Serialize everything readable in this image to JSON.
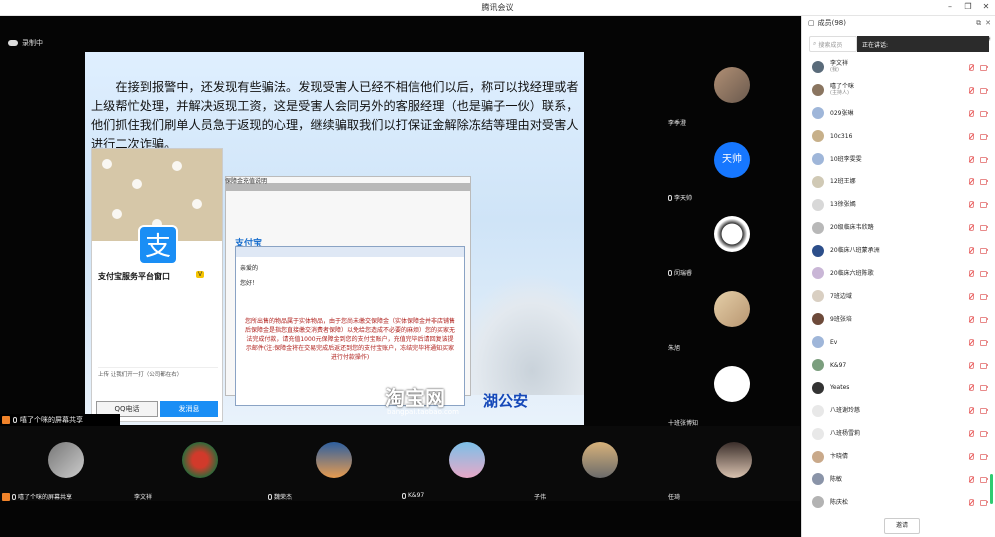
{
  "window": {
    "title": "腾讯会议"
  },
  "stage": {
    "recording_label": "录制中",
    "share_label": "嘻了个咪的屏幕共享",
    "slide": {
      "paragraph": "在接到报警中，还发现有些骗法。发现受害人已经不相信他们以后，称可以找经理或者上级帮忙处理，并解决返现工资，这是受害人会同另外的客服经理（也是骗子一伙）联系，他们抓住我们刷单人员急于返现的心理，继续骗取我们以打保证金解除冻结等理由对受害人进行二次诈骗。",
      "phone": {
        "name": "支付宝服务平台窗口",
        "badge": "V",
        "btn_left": "QQ电话",
        "btn_right": "发消息",
        "logo": "支",
        "row2": "上传 让我们开一打（公司都在右）"
      },
      "web": {
        "header": "保障金充值说明",
        "brand": "支付宝",
        "mail_greet": "亲爱的",
        "mail_hello": "您好！",
        "mail_body": "您所出售的物品属于实体物品，由于您尚未缴交保障金（实体保障金并非店铺售后保障金是指您直接缴交消费者保障）以免给您造成不必要的麻烦）您的买家无法完成付款，请充值1000元保障金到您的支付宝账户，充值完毕后请回复该提示邮件(注:保障金将在交易完成后返还到您的支付宝账户，冻结完毕将通知买家进行付款操作)"
      },
      "watermark_main": "淘宝网",
      "watermark_blue": "湖公安",
      "watermark_url": "bangpai.taobao.com"
    },
    "right_tiles": [
      {
        "name": "李季澄"
      },
      {
        "name": "李天帅",
        "avatar_text": "天帅"
      },
      {
        "name": "闵瑞睿"
      },
      {
        "name": "朱旭"
      },
      {
        "name": "十班张博知"
      }
    ],
    "bottom_tiles": [
      {
        "name": "嘻了个咪的屏幕共享"
      },
      {
        "name": "李文祥"
      },
      {
        "name": "魏荣杰"
      },
      {
        "name": "K&97"
      },
      {
        "name": "子伟"
      },
      {
        "name": "任琦"
      }
    ]
  },
  "panel": {
    "title": "成员(98)",
    "search_placeholder": "搜索成员",
    "speaking_label": "正在讲话:",
    "members": [
      {
        "name": "李文祥",
        "role": "(我)",
        "color": "#5a6b7a"
      },
      {
        "name": "嘻了个咪",
        "role": "(主持人)",
        "color": "#8a7560"
      },
      {
        "name": "029张琳",
        "role": "",
        "color": "#9fb6d9"
      },
      {
        "name": "10c316",
        "role": "",
        "color": "#c7b08a"
      },
      {
        "name": "10班李雯雯",
        "role": "",
        "color": "#9fb6d9"
      },
      {
        "name": "12班王娜",
        "role": "",
        "color": "#d0c9b5"
      },
      {
        "name": "13徐张嫣",
        "role": "",
        "color": "#d8d8d8"
      },
      {
        "name": "20级临床韦欣踏",
        "role": "",
        "color": "#b8b8b8"
      },
      {
        "name": "20临床八班蒙承洲",
        "role": "",
        "color": "#2c4e8a"
      },
      {
        "name": "20临床六班陈歌",
        "role": "",
        "color": "#c9b6d6"
      },
      {
        "name": "7班边域",
        "role": "",
        "color": "#d9cfc2"
      },
      {
        "name": "9班张培",
        "role": "",
        "color": "#6d4a3a"
      },
      {
        "name": "Ev",
        "role": "",
        "color": "#9fb6d9"
      },
      {
        "name": "K&97",
        "role": "",
        "color": "#7b9e7e"
      },
      {
        "name": "Yeates",
        "role": "",
        "color": "#333"
      },
      {
        "name": "八班谢玲慈",
        "role": "",
        "color": "#e8e8e8"
      },
      {
        "name": "八班杨雪莉",
        "role": "",
        "color": "#e8e8e8"
      },
      {
        "name": "卞晓倩",
        "role": "",
        "color": "#c9a98a"
      },
      {
        "name": "陈敏",
        "role": "",
        "color": "#8a94a8"
      },
      {
        "name": "陈庆松",
        "role": "",
        "color": "#b3b3b3"
      }
    ],
    "invite_label": "邀请"
  }
}
